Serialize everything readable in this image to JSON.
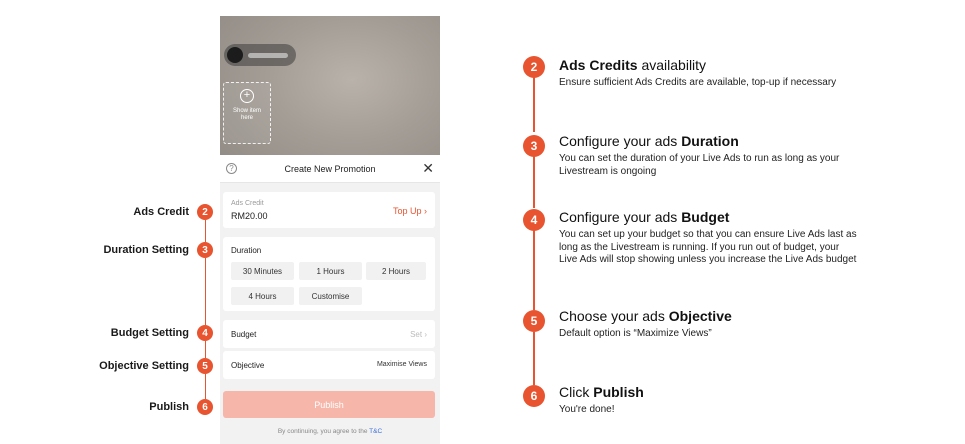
{
  "annotations": [
    {
      "label": "Ads Credit",
      "num": "2"
    },
    {
      "label": "Duration Setting",
      "num": "3"
    },
    {
      "label": "Budget Setting",
      "num": "4"
    },
    {
      "label": "Objective Setting",
      "num": "5"
    },
    {
      "label": "Publish",
      "num": "6"
    }
  ],
  "phone": {
    "show_item": "Show item here",
    "sheet_title": "Create New Promotion",
    "help_glyph": "?",
    "close_glyph": "✕",
    "ads_credit_label": "Ads Credit",
    "ads_credit_value": "RM20.00",
    "top_up": "Top Up ›",
    "duration_label": "Duration",
    "duration_options": [
      "30 Minutes",
      "1 Hours",
      "2 Hours",
      "4 Hours",
      "Customise"
    ],
    "budget_label": "Budget",
    "budget_value": "Set ›",
    "objective_label": "Objective",
    "objective_value": "Maximise Views",
    "publish": "Publish",
    "tnc_prefix": "By continuing, you agree to the ",
    "tnc_link": "T&C"
  },
  "steps": [
    {
      "num": "2",
      "title_bold": "Ads Credits",
      "title_rest": " availability",
      "bold_first": true,
      "desc": "Ensure sufficient Ads Credits are available, top-up if necessary"
    },
    {
      "num": "3",
      "title_pre": "Configure your ads ",
      "title_bold": "Duration",
      "bold_first": false,
      "desc": "You can set the duration of your Live Ads to run as long as your Livestream is ongoing"
    },
    {
      "num": "4",
      "title_pre": "Configure your ads ",
      "title_bold": "Budget",
      "bold_first": false,
      "desc": "You can set up your budget so that you can ensure Live Ads last as long as the Livestream is running. If you run out of budget, your Live Ads will stop showing unless you increase the Live Ads budget"
    },
    {
      "num": "5",
      "title_pre": "Choose your ads ",
      "title_bold": "Objective",
      "bold_first": false,
      "desc": "Default option is “Maximize Views”"
    },
    {
      "num": "6",
      "title_pre": "Click ",
      "title_bold": "Publish",
      "bold_first": false,
      "desc": "You're done!"
    }
  ],
  "colors": {
    "accent": "#e8542f",
    "publish_disabled": "#f6b6a9",
    "link": "#3b6fd8"
  }
}
